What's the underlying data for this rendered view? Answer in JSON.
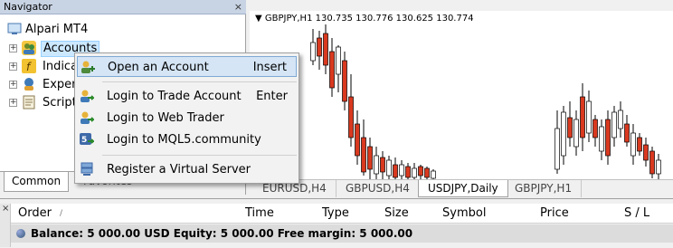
{
  "navigator": {
    "title": "Navigator",
    "close": "×",
    "tree": {
      "root": "Alpari MT4",
      "accounts": "Accounts",
      "indicators": "Indica",
      "experts": "Exper",
      "scripts": "Script"
    },
    "tabs": {
      "common": "Common",
      "favorites": "Favorites"
    }
  },
  "chart": {
    "header": "GBPJPY,H1  130.735 130.776 130.625 130.774",
    "tabs": [
      "EURUSD,H4",
      "GBPUSD,H4",
      "USDJPY,Daily",
      "GBPJPY,H1"
    ],
    "active_tab": "USDJPY,Daily",
    "colors": {
      "bull": "#ffffff",
      "bear": "#d9391f",
      "wick": "#000000"
    }
  },
  "context_menu": {
    "items": [
      {
        "label": "Open an Account",
        "shortcut": "Insert",
        "icon": "user-add-icon",
        "highlighted": true
      },
      {
        "label": "Login to Trade Account",
        "shortcut": "Enter",
        "icon": "login-icon"
      },
      {
        "label": "Login to Web Trader",
        "shortcut": "",
        "icon": "web-login-icon"
      },
      {
        "label": "Login to MQL5.community",
        "shortcut": "",
        "icon": "mql5-icon"
      },
      {
        "label": "Register a Virtual Server",
        "shortcut": "",
        "icon": "server-icon"
      }
    ]
  },
  "terminal": {
    "columns": [
      "Order",
      "/",
      "Time",
      "Type",
      "Size",
      "Symbol",
      "Price",
      "S / L"
    ],
    "balance_line": "Balance: 5 000.00 USD  Equity: 5 000.00  Free margin: 5 000.00",
    "close": "×"
  }
}
